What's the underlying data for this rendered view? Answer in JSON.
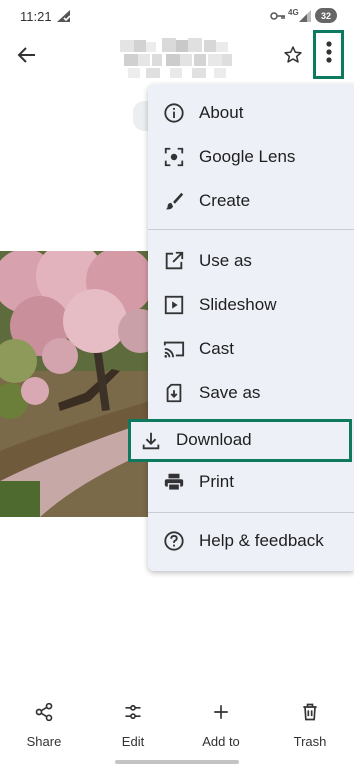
{
  "status_bar": {
    "time": "11:21",
    "network": "4G",
    "battery": "32"
  },
  "menu": {
    "items": [
      {
        "label": "About",
        "icon": "info-icon"
      },
      {
        "label": "Google Lens",
        "icon": "lens-icon"
      },
      {
        "label": "Create",
        "icon": "brush-icon"
      },
      {
        "label": "Use as",
        "icon": "open-external-icon"
      },
      {
        "label": "Slideshow",
        "icon": "slideshow-icon"
      },
      {
        "label": "Cast",
        "icon": "cast-icon"
      },
      {
        "label": "Save as",
        "icon": "save-as-icon"
      },
      {
        "label": "Download",
        "icon": "download-icon"
      },
      {
        "label": "Print",
        "icon": "print-icon"
      },
      {
        "label": "Help & feedback",
        "icon": "help-icon"
      }
    ]
  },
  "bottom_actions": {
    "share": "Share",
    "edit": "Edit",
    "add_to": "Add to",
    "trash": "Trash"
  },
  "colors": {
    "highlight": "#0d7a5f",
    "menu_background": "#edf0f7"
  }
}
